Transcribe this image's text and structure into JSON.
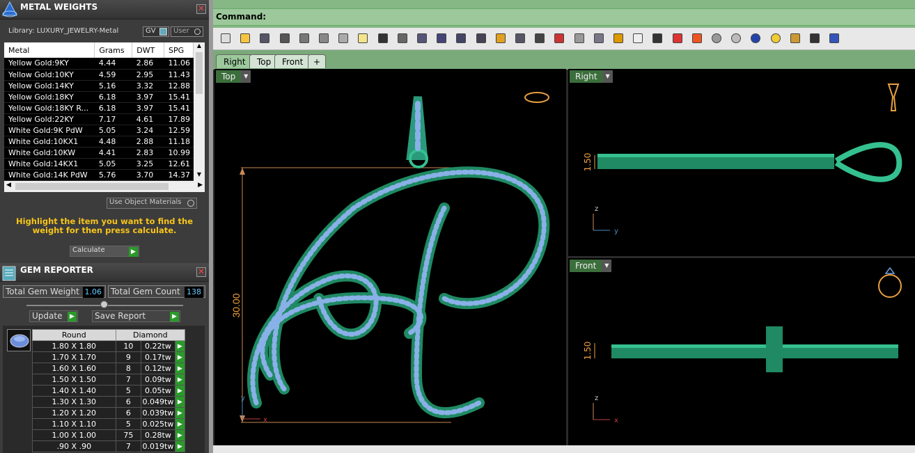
{
  "metal": {
    "title": "METAL WEIGHTS",
    "library_label": "Library: LUXURY_JEWELRY-Metal",
    "gv_label": "GV",
    "user_label": "User",
    "columns": [
      "Metal",
      "Grams",
      "DWT",
      "SPG"
    ],
    "rows": [
      [
        "Yellow Gold:9KY",
        "4.44",
        "2.86",
        "11.06"
      ],
      [
        "Yellow Gold:10KY",
        "4.59",
        "2.95",
        "11.43"
      ],
      [
        "Yellow Gold:14KY",
        "5.16",
        "3.32",
        "12.88"
      ],
      [
        "Yellow Gold:18KY",
        "6.18",
        "3.97",
        "15.41"
      ],
      [
        "Yellow Gold:18KY R...",
        "6.18",
        "3.97",
        "15.41"
      ],
      [
        "Yellow Gold:22KY",
        "7.17",
        "4.61",
        "17.89"
      ],
      [
        "White Gold:9K PdW",
        "5.05",
        "3.24",
        "12.59"
      ],
      [
        "White Gold:10KX1",
        "4.48",
        "2.88",
        "11.18"
      ],
      [
        "White Gold:10KW",
        "4.41",
        "2.83",
        "10.99"
      ],
      [
        "White Gold:14KX1",
        "5.05",
        "3.25",
        "12.61"
      ],
      [
        "White Gold:14K PdW",
        "5.76",
        "3.70",
        "14.37"
      ]
    ],
    "use_object_materials": "Use Object Materials",
    "hint": "Highlight the item you want to find the weight for then press calculate.",
    "calculate_label": "Calculate"
  },
  "gem": {
    "title": "GEM REPORTER",
    "total_weight_label": "Total Gem Weight",
    "total_weight_value": "1.06",
    "total_count_label": "Total Gem Count",
    "total_count_value": "138",
    "update_label": "Update",
    "save_report_label": "Save Report",
    "headers": [
      "Round",
      "Diamond"
    ],
    "rows": [
      [
        "1.80 X 1.80",
        "10",
        "0.22tw"
      ],
      [
        "1.70 X 1.70",
        "9",
        "0.17tw"
      ],
      [
        "1.60 X 1.60",
        "8",
        "0.12tw"
      ],
      [
        "1.50 X 1.50",
        "7",
        "0.09tw"
      ],
      [
        "1.40 X 1.40",
        "5",
        "0.05tw"
      ],
      [
        "1.30 X 1.30",
        "6",
        "0.049tw"
      ],
      [
        "1.20 X 1.20",
        "6",
        "0.039tw"
      ],
      [
        "1.10 X 1.10",
        "5",
        "0.025tw"
      ],
      [
        "1.00 X 1.00",
        "75",
        "0.28tw"
      ],
      [
        ".90 X .90",
        "7",
        "0.019tw"
      ]
    ]
  },
  "command_label": "Command:",
  "view_tabs": [
    "Right",
    "Top",
    "Front"
  ],
  "add_tab": "+",
  "viewports": {
    "top_label": "Top",
    "right_label": "Right",
    "front_label": "Front",
    "dim_height": "30.00",
    "dim_right": "1.50",
    "dim_front": "1.50",
    "axis_x": "x",
    "axis_y": "y",
    "axis_z": "z"
  },
  "toolbar_icons": [
    "new-icon",
    "open-icon",
    "save-icon",
    "print-icon",
    "export-icon",
    "cut-icon",
    "copy-icon",
    "paste-icon",
    "undo-icon",
    "pan-icon",
    "rotate-icon",
    "zoom-icon",
    "zoom-window-icon",
    "zoom-extents-icon",
    "zoom-selected-icon",
    "rotate-view-icon",
    "four-views-icon",
    "car-icon",
    "hide-icon",
    "snap-icon",
    "points-icon",
    "light-icon",
    "lock-icon",
    "layers-icon",
    "color-icon",
    "shade-icon",
    "render-icon",
    "sphere-icon",
    "pointer-icon",
    "settings-icon",
    "bounding-icon",
    "help-icon"
  ],
  "accent": "#2a9a2a"
}
